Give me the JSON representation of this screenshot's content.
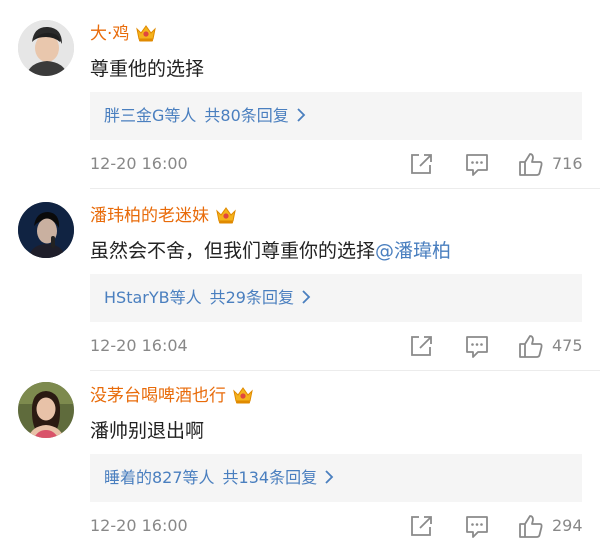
{
  "comments": [
    {
      "username": "大·鸡",
      "text": "尊重他的选择",
      "mention": "",
      "reply_users": "胖三金G等人",
      "reply_count": "共80条回复",
      "time": "12-20 16:00",
      "likes": "716"
    },
    {
      "username": "潘玮柏的老迷妹",
      "text": "虽然会不舍，但我们尊重你的选择",
      "mention": "@潘瑋柏",
      "reply_users": "HStarYB等人",
      "reply_count": "共29条回复",
      "time": "12-20 16:04",
      "likes": "475"
    },
    {
      "username": "没茅台喝啤酒也行",
      "text": "潘帅别退出啊",
      "mention": "",
      "reply_users": "睡着的827等人",
      "reply_count": "共134条回复",
      "time": "12-20 16:00",
      "likes": "294"
    }
  ],
  "colors": {
    "username": "#e86b0a",
    "link": "#4a7fbf",
    "meta": "#888888",
    "reply_bg": "#f5f5f5"
  },
  "icons": [
    "crown-badge-icon",
    "chevron-right-icon",
    "share-icon",
    "comment-icon",
    "thumbs-up-icon"
  ]
}
